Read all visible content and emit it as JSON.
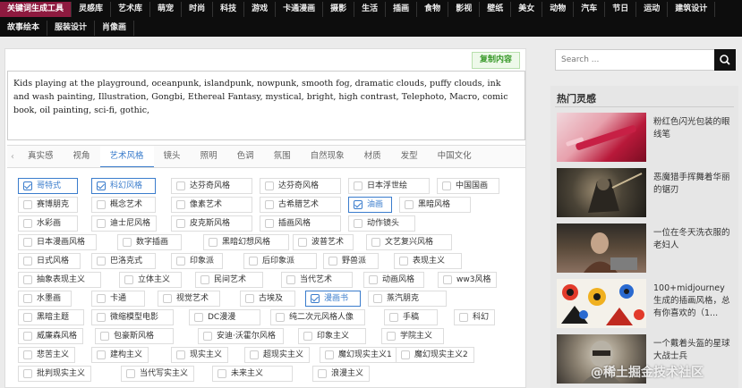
{
  "nav": {
    "row1": [
      "关键词生成工具",
      "灵感库",
      "艺术库",
      "萌宠",
      "时尚",
      "科技",
      "游戏",
      "卡通漫画",
      "摄影",
      "生活",
      "插画",
      "食物",
      "影视",
      "壁纸",
      "美女",
      "动物",
      "汽车",
      "节日",
      "运动",
      "建筑设计"
    ],
    "row2": [
      "故事绘本",
      "服装设计",
      "肖像画"
    ]
  },
  "prompt": {
    "text": "Kids playing at the playground, oceanpunk, islandpunk, nowpunk, smooth fog, dramatic clouds, puffy clouds, ink and wash painting, Illustration, Gongbi, Ethereal Fantasy, mystical, bright, high contrast, Telephoto, Macro, comic book, oil painting, sci-fi, gothic,",
    "copy_label": "复制内容"
  },
  "tabs": [
    "真实感",
    "视角",
    "艺术风格",
    "镜头",
    "照明",
    "色调",
    "氛围",
    "自然现象",
    "材质",
    "发型",
    "中国文化"
  ],
  "active_tab": "艺术风格",
  "tags": [
    {
      "label": "哥特式",
      "checked": true
    },
    {
      "label": "科幻风格",
      "checked": true
    },
    {
      "label": "达芬奇风格",
      "checked": false
    },
    {
      "label": "达芬奇风格",
      "checked": false
    },
    {
      "label": "日本浮世绘",
      "checked": false
    },
    {
      "label": "中国国画",
      "checked": false
    },
    {
      "label": "赛博朋克",
      "checked": false
    },
    {
      "label": "概念艺术",
      "checked": false
    },
    {
      "label": "像素艺术",
      "checked": false
    },
    {
      "label": "古希腊艺术",
      "checked": false
    },
    {
      "label": "油画",
      "checked": true
    },
    {
      "label": "黑暗风格",
      "checked": false
    },
    {
      "label": "水彩画",
      "checked": false
    },
    {
      "label": "迪士尼风格",
      "checked": false
    },
    {
      "label": "皮克斯风格",
      "checked": false
    },
    {
      "label": "插画风格",
      "checked": false
    },
    {
      "label": "动作镜头",
      "checked": false
    },
    {
      "label": "日本漫画风格",
      "checked": false
    },
    {
      "label": "数字插画",
      "checked": false
    },
    {
      "label": "黑暗幻想风格",
      "checked": false
    },
    {
      "label": "波普艺术",
      "checked": false
    },
    {
      "label": "文艺复兴风格",
      "checked": false
    },
    {
      "label": "日式风格",
      "checked": false
    },
    {
      "label": "巴洛克式",
      "checked": false
    },
    {
      "label": "印象派",
      "checked": false
    },
    {
      "label": "后印象派",
      "checked": false
    },
    {
      "label": "野兽派",
      "checked": false
    },
    {
      "label": "表现主义",
      "checked": false
    },
    {
      "label": "抽象表现主义",
      "checked": false
    },
    {
      "label": "立体主义",
      "checked": false
    },
    {
      "label": "民间艺术",
      "checked": false
    },
    {
      "label": "当代艺术",
      "checked": false
    },
    {
      "label": "动画风格",
      "checked": false
    },
    {
      "label": "ww3风格",
      "checked": false
    },
    {
      "label": "水墨画",
      "checked": false
    },
    {
      "label": "卡通",
      "checked": false
    },
    {
      "label": "视觉艺术",
      "checked": false
    },
    {
      "label": "古埃及",
      "checked": false
    },
    {
      "label": "漫画书",
      "checked": true
    },
    {
      "label": "蒸汽朋克",
      "checked": false
    },
    {
      "label": "黑暗主题",
      "checked": false
    },
    {
      "label": "微缩模型电影",
      "checked": false
    },
    {
      "label": "DC漫漫",
      "checked": false
    },
    {
      "label": "纯二次元风格人像",
      "checked": false
    },
    {
      "label": "手稿",
      "checked": false
    },
    {
      "label": "科幻",
      "checked": false
    },
    {
      "label": "威廉森风格",
      "checked": false
    },
    {
      "label": "包豪斯风格",
      "checked": false
    },
    {
      "label": "安迪·沃霍尔风格",
      "checked": false
    },
    {
      "label": "印象主义",
      "checked": false
    },
    {
      "label": "学院主义",
      "checked": false
    },
    {
      "label": "悲苦主义",
      "checked": false
    },
    {
      "label": "建构主义",
      "checked": false
    },
    {
      "label": "现实主义",
      "checked": false
    },
    {
      "label": "超现实主义",
      "checked": false
    },
    {
      "label": "魔幻现实主义1",
      "checked": false
    },
    {
      "label": "魔幻现实主义2",
      "checked": false
    },
    {
      "label": "批判现实主义",
      "checked": false
    },
    {
      "label": "当代写实主义",
      "checked": false
    },
    {
      "label": "未来主义",
      "checked": false
    },
    {
      "label": "浪漫主义",
      "checked": false
    }
  ],
  "search": {
    "placeholder": "Search ..."
  },
  "sidebar": {
    "title": "热门灵感",
    "items": [
      {
        "title": "粉红色闪光包装的眼线笔"
      },
      {
        "title": "恶魔猎手挥舞着华丽的锯刃"
      },
      {
        "title": "一位在冬天洗衣服的老妇人"
      },
      {
        "title": "100+midjourney生成的插画风格，总有你喜欢的（1..."
      },
      {
        "title": "一个戴着头盔的星球大战士兵"
      }
    ]
  },
  "watermark": "@稀土掘金技术社区",
  "colors": {
    "accent": "#3a7ccc",
    "nav_active": "#8e1a3f",
    "copy_green": "#3a9a2b"
  }
}
